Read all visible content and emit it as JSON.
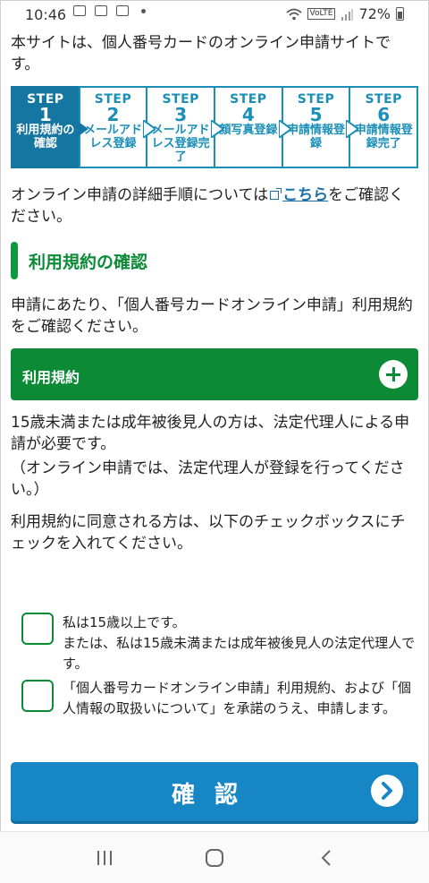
{
  "status_bar": {
    "time": "10:46",
    "battery": "72%",
    "notification_icons": [
      "news-icon",
      "photo-icon",
      "photo-icon"
    ]
  },
  "intro": "本サイトは、個人番号カードのオンライン申請サイトです。",
  "steps": [
    {
      "step": "STEP",
      "num": "1",
      "label": "利用規約の確認",
      "active": true
    },
    {
      "step": "STEP",
      "num": "2",
      "label": "メールアドレス登録",
      "active": false
    },
    {
      "step": "STEP",
      "num": "3",
      "label": "メールアドレス登録完了",
      "active": false
    },
    {
      "step": "STEP",
      "num": "4",
      "label": "顔写真登録",
      "active": false
    },
    {
      "step": "STEP",
      "num": "5",
      "label": "申請情報登録",
      "active": false
    },
    {
      "step": "STEP",
      "num": "6",
      "label": "申請情報登録完了",
      "active": false
    }
  ],
  "detail": {
    "prefix": "オンライン申請の詳細手順については",
    "link": "こちら",
    "suffix": "をご確認ください。"
  },
  "section_title": "利用規約の確認",
  "terms_intro": "申請にあたり、「個人番号カードオンライン申請」利用規約をご確認ください。",
  "accordion_label": "利用規約",
  "minor_note_1": "15歳未満または成年被後見人の方は、法定代理人による申請が必要です。",
  "minor_note_2": "（オンライン申請では、法定代理人が登録を行ってください。）",
  "agree_note": "利用規約に同意される方は、以下のチェックボックスにチェックを入れてください。",
  "checkbox_age_line1": "私は15歳以上です。",
  "checkbox_age_line2": "または、私は15歳未満または成年被後見人の法定代理人です。",
  "checkbox_terms": "「個人番号カードオンライン申請」利用規約、および「個人情報の取扱いについて」を承諾のうえ、申請します。",
  "confirm_button": "確認",
  "colors": {
    "green": "#0c8a35",
    "step_blue": "#1a8fb7",
    "button_blue": "#1687c4"
  }
}
